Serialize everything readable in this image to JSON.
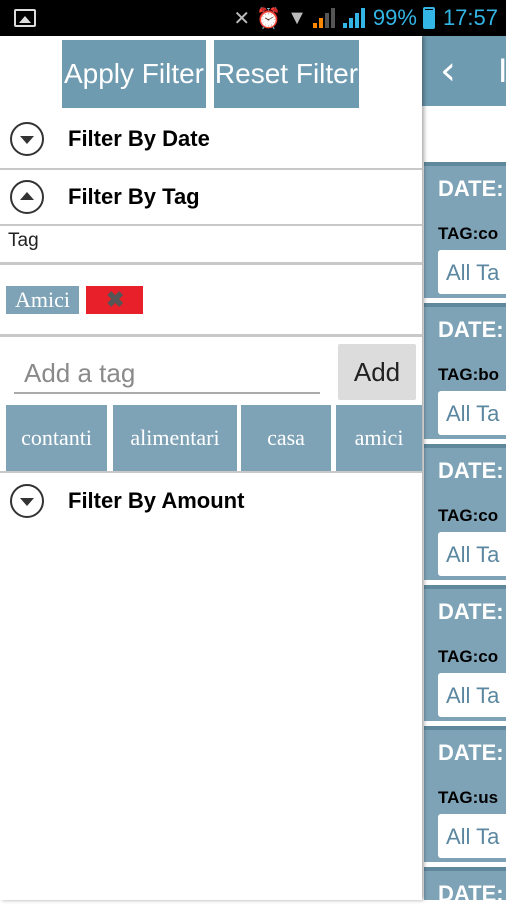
{
  "status_bar": {
    "battery": "99%",
    "time": "17:57",
    "icons": [
      "image-icon",
      "mute-icon",
      "alarm-icon",
      "wifi-icon",
      "signal-icon",
      "signal-icon",
      "battery-icon"
    ],
    "accent": "#33b5e5"
  },
  "colors": {
    "accent": "#6f9bb1",
    "chip": "#7ea3b7",
    "remove": "#e8202a"
  },
  "drawer": {
    "apply_label": "Apply Filter",
    "reset_label": "Reset Filter",
    "sections": {
      "date": "Filter By Date",
      "tag": "Filter By Tag",
      "amount": "Filter By Amount"
    },
    "tag_field_label": "Tag",
    "selected_tags": [
      "Amici"
    ],
    "add_placeholder": "Add a tag",
    "add_label": "Add",
    "suggestions": [
      "contanti",
      "alimentari",
      "casa",
      "amici"
    ]
  },
  "background_list": {
    "back_icon": "chevron-left-icon",
    "title_fragment": "I",
    "items": [
      {
        "date": "DATE:",
        "tag": "TAG:co",
        "button": "All Ta"
      },
      {
        "date": "DATE:",
        "tag": "TAG:bo",
        "button": "All Ta"
      },
      {
        "date": "DATE:",
        "tag": "TAG:co",
        "button": "All Ta"
      },
      {
        "date": "DATE:",
        "tag": "TAG:co",
        "button": "All Ta"
      },
      {
        "date": "DATE:",
        "tag": "TAG:us",
        "button": "All Ta"
      },
      {
        "date": "DATE:"
      }
    ]
  }
}
